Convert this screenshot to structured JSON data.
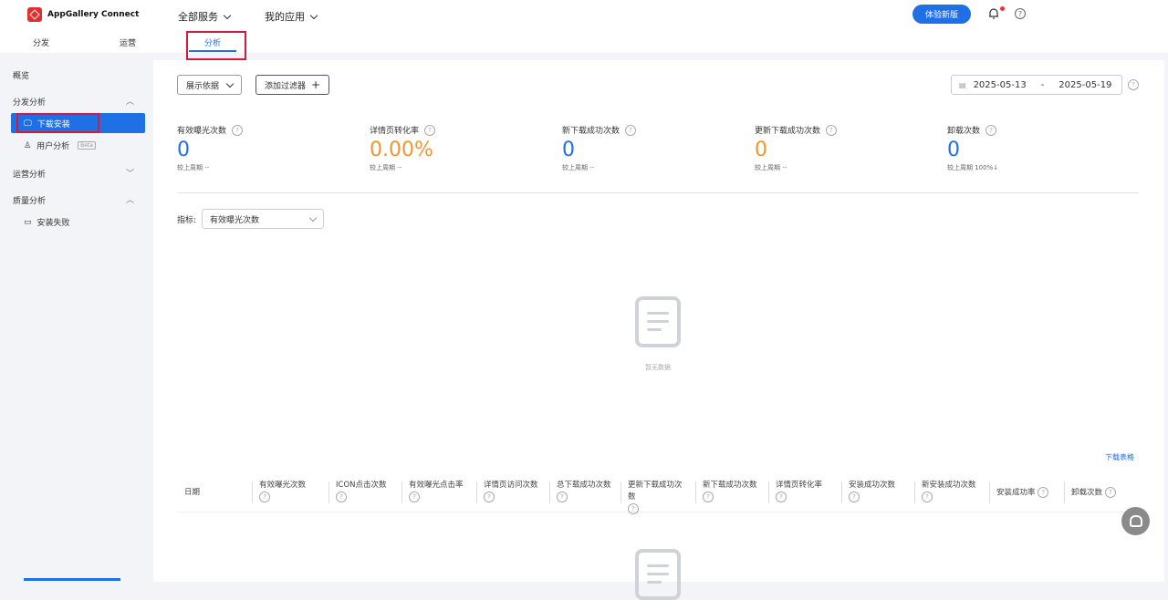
{
  "brand": {
    "name": "AppGallery Connect"
  },
  "topnav": {
    "all_services": "全部服务",
    "my_apps": "我的应用",
    "try_new": "体验新版"
  },
  "subtabs": {
    "distribute": "分发",
    "operate": "运营",
    "analyze": "分析"
  },
  "sidebar": {
    "overview": "概览",
    "dist_analysis": "分发分析",
    "download_install": "下载安装",
    "user_analysis": "用户分析",
    "beta": "Beta",
    "ops_analysis": "运营分析",
    "quality_analysis": "质量分析",
    "install_fail": "安装失败"
  },
  "toolbar": {
    "display_by": "展示依据",
    "add_filter": "添加过滤器",
    "add_icon": "+"
  },
  "date_range": {
    "start": "2025-05-13",
    "sep": "-",
    "end": "2025-05-19"
  },
  "metrics": [
    {
      "label": "有效曝光次数",
      "value": "0",
      "compare": "较上周期 --"
    },
    {
      "label": "详情页转化率",
      "value": "0.00%",
      "compare": "较上周期 --"
    },
    {
      "label": "新下载成功次数",
      "value": "0",
      "compare": "较上周期 --"
    },
    {
      "label": "更新下载成功次数",
      "value": "0",
      "compare": "较上周期 --"
    },
    {
      "label": "卸载次数",
      "value": "0",
      "compare": "较上周期 100%↓"
    }
  ],
  "indicator": {
    "label": "指标:",
    "selected": "有效曝光次数"
  },
  "empty": {
    "text": "暂无数据"
  },
  "table": {
    "download_link": "下载表格",
    "columns": [
      "日期",
      "有效曝光次数",
      "ICON点击次数",
      "有效曝光点击率",
      "详情页访问次数",
      "总下载成功次数",
      "更新下载成功次数",
      "新下载成功次数",
      "详情页转化率",
      "安装成功次数",
      "新安装成功次数",
      "安装成功率",
      "卸载次数"
    ]
  },
  "colors": {
    "accent": "#1f6fe5",
    "orange": "#f0962e",
    "highlight_box": "#d11a3c"
  }
}
